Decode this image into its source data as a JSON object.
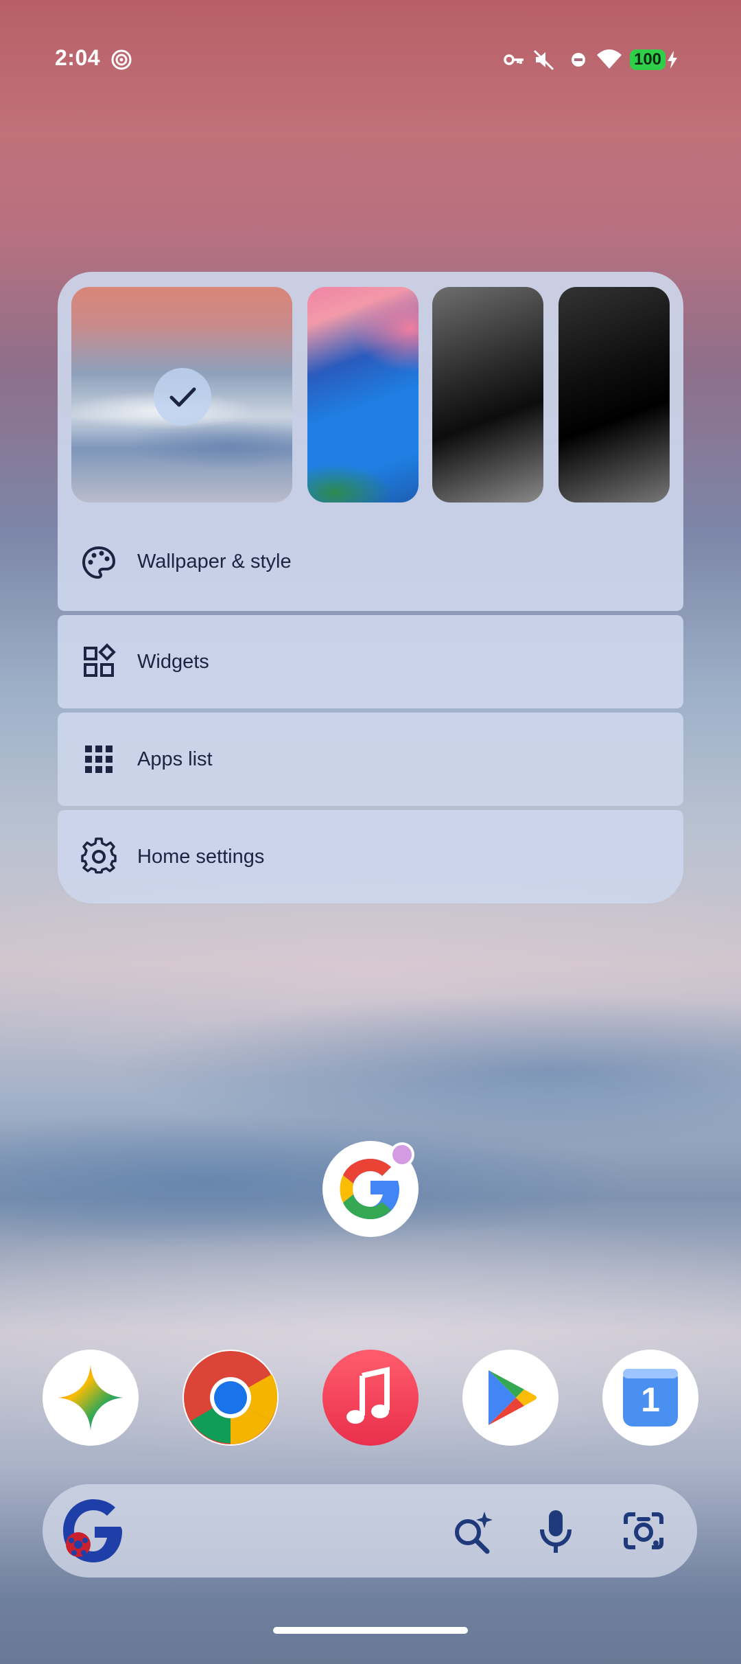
{
  "status_bar": {
    "time": "2:04",
    "battery_level": "100",
    "icons": [
      "hotspot-icon",
      "vpn-key-icon",
      "silent-icon",
      "do-not-disturb-icon",
      "wifi-icon",
      "battery-charging-icon"
    ]
  },
  "long_press_menu": {
    "wallpapers": [
      {
        "name": "wallpaper-fog",
        "selected": true
      },
      {
        "name": "wallpaper-abstract-blue-pink",
        "selected": false
      },
      {
        "name": "wallpaper-dark-gray",
        "selected": false
      },
      {
        "name": "wallpaper-black",
        "selected": false
      }
    ],
    "items": [
      {
        "label": "Wallpaper & style",
        "icon": "palette-icon"
      },
      {
        "label": "Widgets",
        "icon": "widgets-icon"
      },
      {
        "label": "Apps list",
        "icon": "apps-grid-icon"
      },
      {
        "label": "Home settings",
        "icon": "gear-icon"
      }
    ]
  },
  "home": {
    "center_app": {
      "name": "Google",
      "has_notification": true
    },
    "dock": [
      "Gemini",
      "Chrome",
      "Music",
      "Play Store",
      "Calendar"
    ],
    "calendar_day": "1",
    "search_bar": {
      "actions": [
        "ai-search-icon",
        "microphone-icon",
        "lens-camera-icon"
      ]
    }
  },
  "colors": {
    "menu_text": "#1b2440",
    "menu_bg": "#ccd6ec",
    "battery": "#2fcf4a"
  }
}
